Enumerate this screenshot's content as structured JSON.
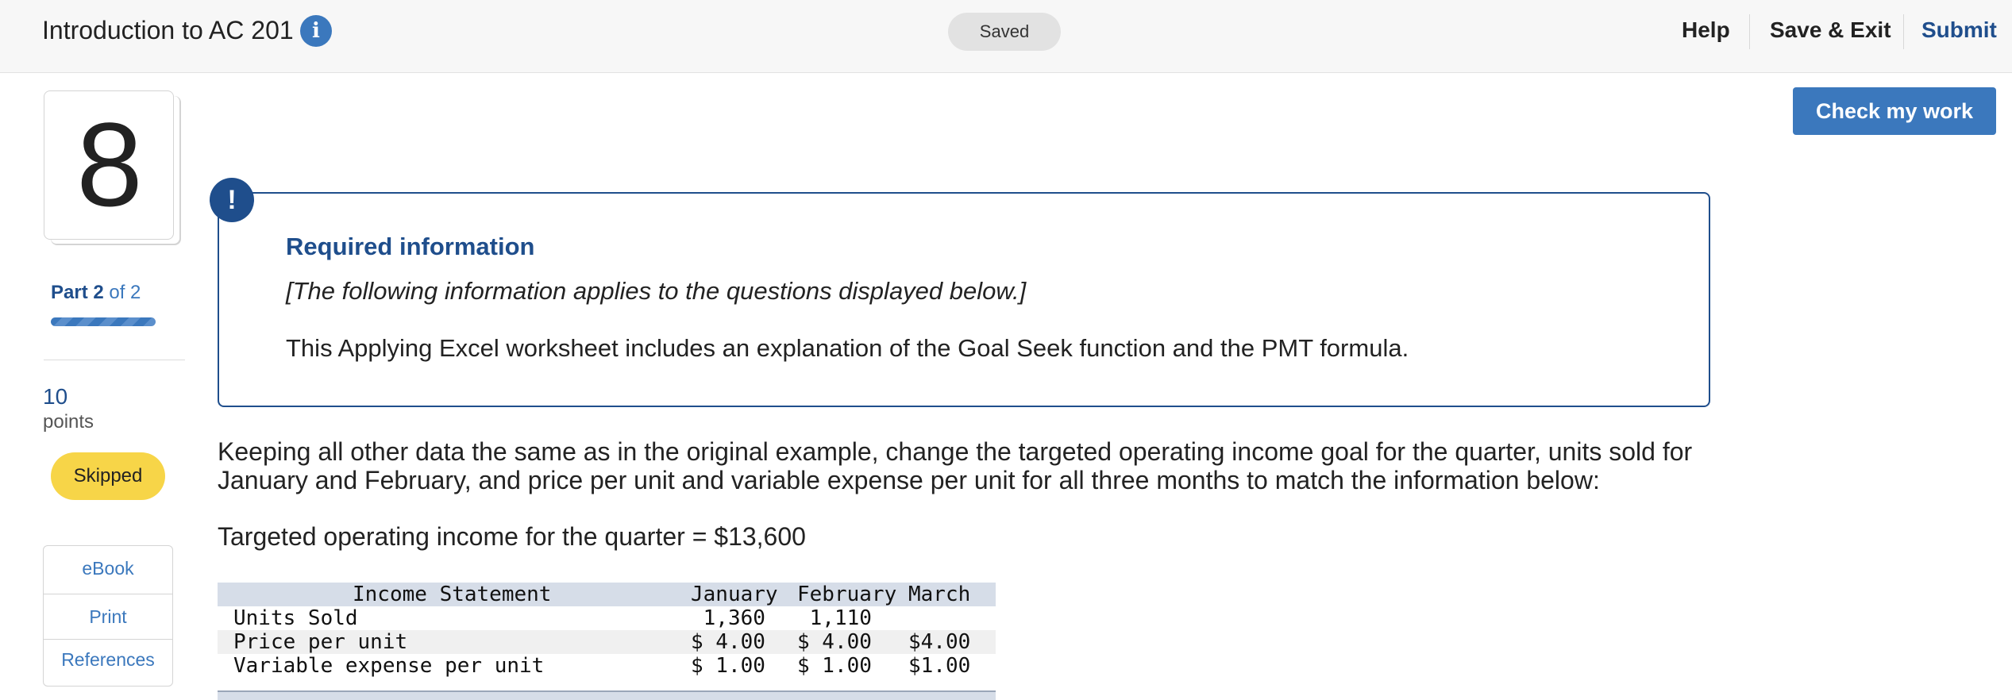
{
  "header": {
    "title": "Introduction to AC 201",
    "info_icon": "i",
    "saved_label": "Saved",
    "help_label": "Help",
    "save_exit_label": "Save & Exit",
    "submit_label": "Submit"
  },
  "sidebar": {
    "question_number": "8",
    "part_current": "Part 2",
    "part_total": " of 2",
    "part_progress": 1.0,
    "points_value": "10",
    "points_label": "points",
    "status_badge": "Skipped",
    "resources": [
      {
        "label": "eBook"
      },
      {
        "label": "Print"
      },
      {
        "label": "References"
      }
    ]
  },
  "check_button_label": "Check my work",
  "required_info": {
    "alert_glyph": "!",
    "title": "Required information",
    "italic_note": "[The following information applies to the questions displayed below.]",
    "body": "This Applying Excel worksheet includes an explanation of the Goal Seek function and the PMT formula."
  },
  "question": {
    "text": "Keeping all other data the same as in the original example, change the targeted operating income goal for the quarter, units sold for January and February, and price per unit and variable expense per unit for all three months to match the information below:",
    "target_line": "Targeted operating income for the quarter = $13,600"
  },
  "income_table": {
    "header": {
      "label": "Income Statement",
      "jan": "January",
      "feb": "February",
      "mar": "March"
    },
    "rows": [
      {
        "label": "Units Sold",
        "jan": " 1,360",
        "feb": " 1,110",
        "mar": ""
      },
      {
        "label": "Price per unit",
        "jan": "$ 4.00",
        "feb": "$ 4.00",
        "mar": "$4.00"
      },
      {
        "label": "Variable expense per unit",
        "jan": "$ 1.00",
        "feb": "$ 1.00",
        "mar": "$1.00"
      }
    ]
  },
  "colors": {
    "brand_blue": "#3b78bd",
    "dark_blue": "#1f4e8c",
    "skipped_yellow": "#f7d548"
  }
}
